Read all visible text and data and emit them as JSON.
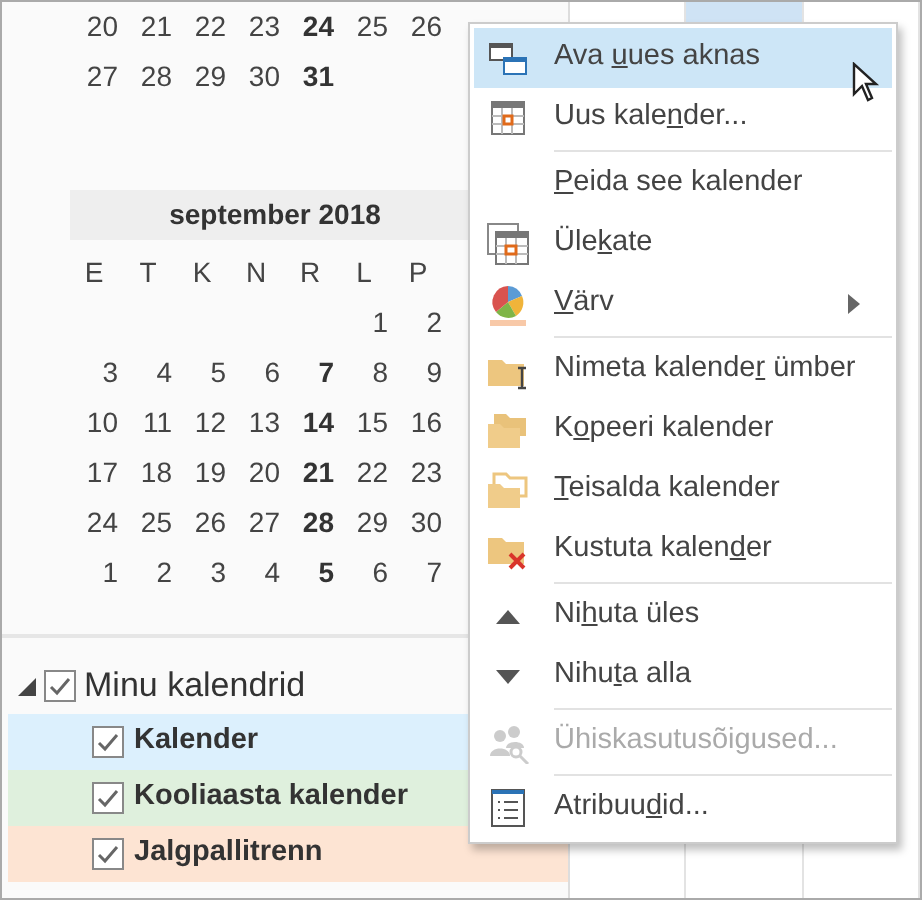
{
  "prev_month": {
    "rows": [
      [
        "20",
        "21",
        "22",
        "23",
        "24",
        "25",
        "26"
      ],
      [
        "27",
        "28",
        "29",
        "30",
        "31",
        null,
        null
      ]
    ]
  },
  "month": {
    "title": "september 2018",
    "weekdays": [
      "E",
      "T",
      "K",
      "N",
      "R",
      "L",
      "P"
    ],
    "rows": [
      [
        null,
        null,
        null,
        null,
        null,
        "1",
        "2"
      ],
      [
        "3",
        "4",
        "5",
        "6",
        "7",
        "8",
        "9"
      ],
      [
        "10",
        "11",
        "12",
        "13",
        "14",
        "15",
        "16"
      ],
      [
        "17",
        "18",
        "19",
        "20",
        "21",
        "22",
        "23"
      ],
      [
        "24",
        "25",
        "26",
        "27",
        "28",
        "29",
        "30"
      ],
      [
        "1",
        "2",
        "3",
        "4",
        "5",
        "6",
        "7"
      ]
    ]
  },
  "calendar_group": {
    "label": "Minu kalendrid",
    "expanded": true,
    "checked": true,
    "calendars": [
      {
        "label": "Kalender",
        "checked": true,
        "color": "#dcf0fd"
      },
      {
        "label": "Kooliaasta kalender",
        "checked": true,
        "color": "#dff0dd"
      },
      {
        "label": "Jalgpallitrenn",
        "checked": true,
        "color": "#fde4d3"
      }
    ]
  },
  "context_menu": [
    {
      "kind": "item",
      "label_parts": [
        {
          "text": "Ava ",
          "access_key": false
        },
        {
          "text": "u",
          "access_key": true
        },
        {
          "text": "ues aknas",
          "access_key": false
        }
      ],
      "selected": true,
      "disabled": false
    },
    {
      "kind": "item",
      "label_parts": [
        {
          "text": "Uus kale",
          "access_key": false
        },
        {
          "text": "n",
          "access_key": true
        },
        {
          "text": "der...",
          "access_key": false
        }
      ],
      "selected": false,
      "disabled": false
    },
    {
      "kind": "separator"
    },
    {
      "kind": "item",
      "label_parts": [
        {
          "text": "P",
          "access_key": true
        },
        {
          "text": "eida see kalender",
          "access_key": false
        }
      ],
      "selected": false,
      "disabled": false
    },
    {
      "kind": "item",
      "label_parts": [
        {
          "text": "Üle",
          "access_key": false
        },
        {
          "text": "k",
          "access_key": true
        },
        {
          "text": "ate",
          "access_key": false
        }
      ],
      "selected": false,
      "disabled": false
    },
    {
      "kind": "submenu",
      "label_parts": [
        {
          "text": "V",
          "access_key": true
        },
        {
          "text": "ärv",
          "access_key": false
        }
      ],
      "selected": false,
      "disabled": false
    },
    {
      "kind": "separator"
    },
    {
      "kind": "item",
      "label_parts": [
        {
          "text": "Nimeta kalende",
          "access_key": false
        },
        {
          "text": "r",
          "access_key": true
        },
        {
          "text": " ümber",
          "access_key": false
        }
      ],
      "selected": false,
      "disabled": false
    },
    {
      "kind": "item",
      "label_parts": [
        {
          "text": "K",
          "access_key": false
        },
        {
          "text": "o",
          "access_key": true
        },
        {
          "text": "peeri kalender",
          "access_key": false
        }
      ],
      "selected": false,
      "disabled": false
    },
    {
      "kind": "item",
      "label_parts": [
        {
          "text": "T",
          "access_key": true
        },
        {
          "text": "eisalda kalender",
          "access_key": false
        }
      ],
      "selected": false,
      "disabled": false
    },
    {
      "kind": "item",
      "label_parts": [
        {
          "text": "Kustuta kalen",
          "access_key": false
        },
        {
          "text": "d",
          "access_key": true
        },
        {
          "text": "er",
          "access_key": false
        }
      ],
      "selected": false,
      "disabled": false
    },
    {
      "kind": "separator"
    },
    {
      "kind": "item",
      "label_parts": [
        {
          "text": "Ni",
          "access_key": false
        },
        {
          "text": "h",
          "access_key": true
        },
        {
          "text": "uta üles",
          "access_key": false
        }
      ],
      "selected": false,
      "disabled": false
    },
    {
      "kind": "item",
      "label_parts": [
        {
          "text": "Nihu",
          "access_key": false
        },
        {
          "text": "t",
          "access_key": true
        },
        {
          "text": "a alla",
          "access_key": false
        }
      ],
      "selected": false,
      "disabled": false
    },
    {
      "kind": "separator"
    },
    {
      "kind": "item",
      "label_parts": [
        {
          "text": "Ühiskasutusõigused...",
          "access_key": false
        }
      ],
      "selected": false,
      "disabled": true
    },
    {
      "kind": "separator"
    },
    {
      "kind": "item",
      "label_parts": [
        {
          "text": "Atribuu",
          "access_key": false
        },
        {
          "text": "d",
          "access_key": true
        },
        {
          "text": "id...",
          "access_key": false
        }
      ],
      "selected": false,
      "disabled": false
    }
  ]
}
